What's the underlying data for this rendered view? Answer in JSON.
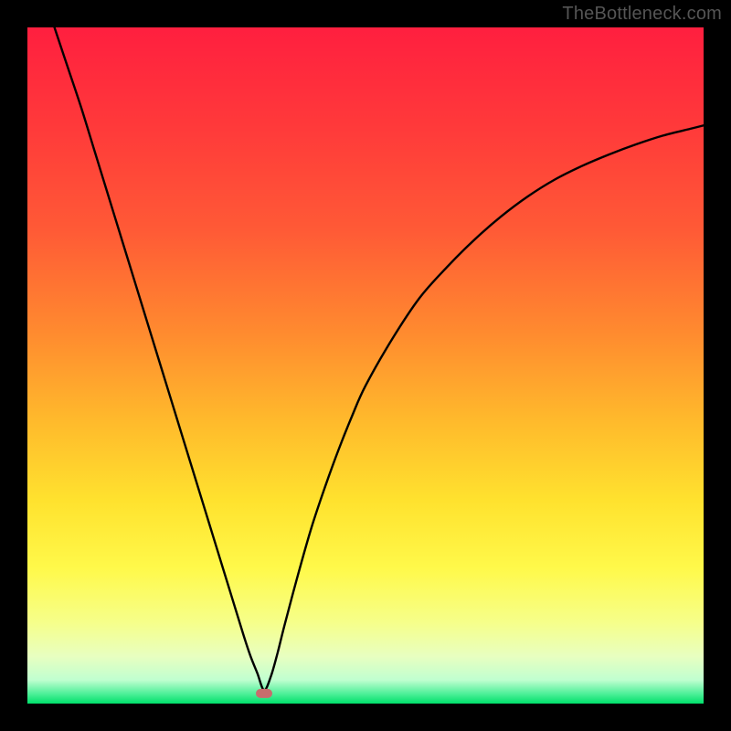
{
  "watermark": {
    "text": "TheBottleneck.com"
  },
  "chart_data": {
    "type": "line",
    "title": "",
    "xlabel": "",
    "ylabel": "",
    "xlim": [
      0,
      100
    ],
    "ylim": [
      0,
      100
    ],
    "grid": false,
    "legend": false,
    "annotations": [
      {
        "type": "marker",
        "x": 35,
        "y": 1.5,
        "color": "#c76d6d",
        "shape": "pill"
      }
    ],
    "background_gradient": {
      "orientation": "vertical",
      "stops": [
        {
          "pos": 0.0,
          "color": "#ff1f3f"
        },
        {
          "pos": 0.15,
          "color": "#ff3a3a"
        },
        {
          "pos": 0.3,
          "color": "#ff5a36"
        },
        {
          "pos": 0.45,
          "color": "#ff8a2f"
        },
        {
          "pos": 0.58,
          "color": "#ffb92c"
        },
        {
          "pos": 0.7,
          "color": "#ffe22e"
        },
        {
          "pos": 0.8,
          "color": "#fff94a"
        },
        {
          "pos": 0.88,
          "color": "#f6ff8a"
        },
        {
          "pos": 0.93,
          "color": "#e8ffc0"
        },
        {
          "pos": 0.965,
          "color": "#c0ffd0"
        },
        {
          "pos": 0.985,
          "color": "#50f09a"
        },
        {
          "pos": 1.0,
          "color": "#00e06b"
        }
      ]
    },
    "series": [
      {
        "name": "bottleneck-curve",
        "color": "#000000",
        "x": [
          4,
          6,
          8,
          10,
          12,
          14,
          16,
          18,
          20,
          22,
          24,
          26,
          28,
          30,
          32,
          33,
          34,
          35,
          36,
          37,
          38,
          40,
          42,
          44,
          46,
          48,
          50,
          54,
          58,
          62,
          66,
          70,
          74,
          78,
          82,
          86,
          90,
          94,
          98,
          100
        ],
        "y": [
          100,
          94,
          88,
          81.5,
          75,
          68.5,
          62,
          55.5,
          49,
          42.5,
          36,
          29.5,
          23,
          16.5,
          10,
          7,
          4.5,
          2,
          4,
          7.5,
          11.5,
          19,
          26,
          32,
          37.5,
          42.5,
          47,
          54,
          60,
          64.5,
          68.5,
          72,
          75,
          77.5,
          79.5,
          81.2,
          82.7,
          84,
          85,
          85.5
        ]
      }
    ]
  }
}
